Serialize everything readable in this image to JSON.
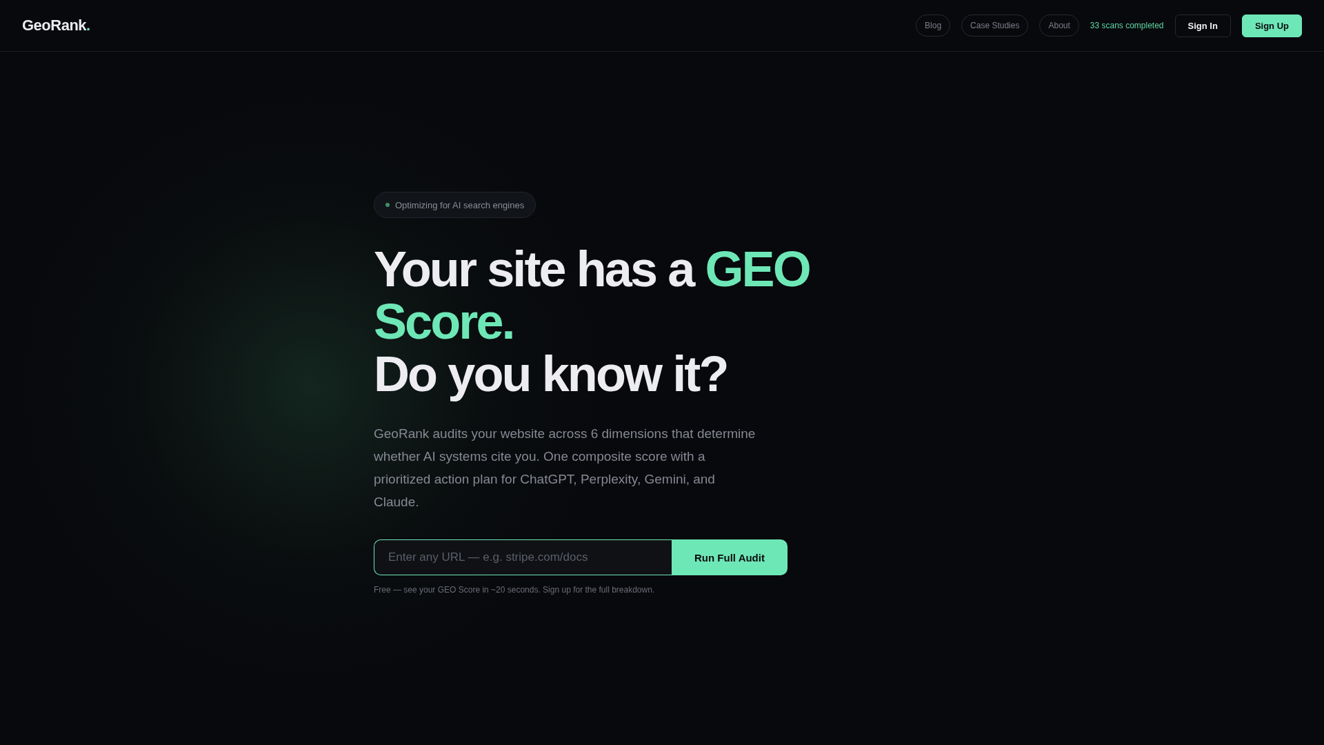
{
  "header": {
    "logo": {
      "name": "GeoRank",
      "mark": "."
    },
    "nav": [
      {
        "label": "Blog"
      },
      {
        "label": "Case Studies"
      },
      {
        "label": "About"
      }
    ],
    "scan_count": "33 scans completed",
    "buttons": [
      {
        "kind": "outline",
        "label": "Sign In"
      },
      {
        "kind": "primary",
        "label": "Sign Up"
      }
    ]
  },
  "hero": {
    "badge": "Optimizing for AI search engines",
    "headline": [
      [
        {
          "text": "Your site has a ",
          "accent": false
        },
        {
          "text": "GEO Score.",
          "accent": true
        }
      ],
      [
        {
          "text": "Do you know it?",
          "accent": false
        }
      ]
    ],
    "description": "GeoRank audits your website across 6 dimensions that determine whether AI systems cite you. One composite score with a prioritized action plan for ChatGPT, Perplexity, Gemini, and Claude.",
    "url_field": {
      "placeholder": "Enter any URL — e.g. stripe.com/docs"
    },
    "submit": "Run Full Audit",
    "note": "Free — see your GEO Score in ~20 seconds. Sign up for the full breakdown."
  }
}
